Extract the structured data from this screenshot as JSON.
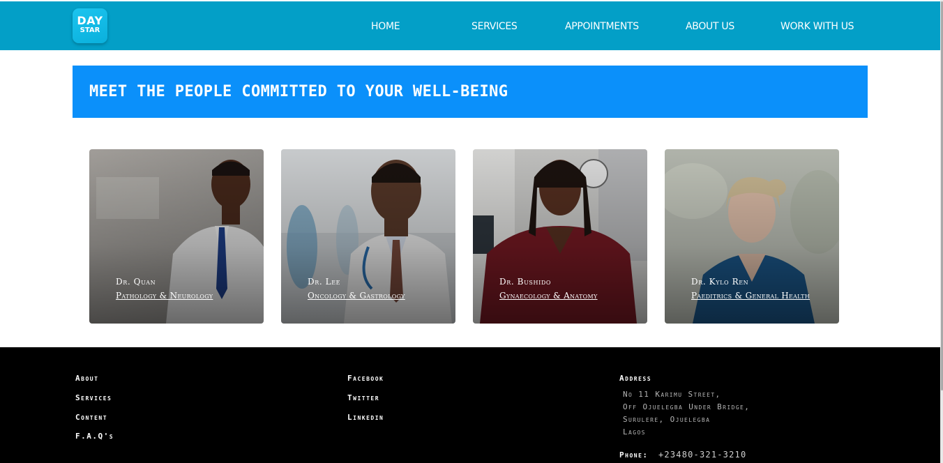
{
  "brand": {
    "logo_line1": "DAY",
    "logo_line2": "STAR",
    "color": "#039fc7"
  },
  "nav": {
    "items": [
      {
        "label": "HOME"
      },
      {
        "label": "SERVICES"
      },
      {
        "label": "APPOINTMENTS"
      },
      {
        "label": "ABOUT US"
      },
      {
        "label": "WORK WITH US"
      }
    ]
  },
  "hero": {
    "title": "MEET THE PEOPLE COMMITTED TO YOUR WELL-BEING",
    "color": "#0b90fa"
  },
  "doctors": [
    {
      "name": "Dr. Quan",
      "specialty": "Pathology & Neurology"
    },
    {
      "name": "Dr. Lee",
      "specialty": "Oncology & Gastrology"
    },
    {
      "name": "Dr. Bushido",
      "specialty": "Gynaecology & Anatomy"
    },
    {
      "name": "Dr. Kylo Ren",
      "specialty": "Paeditrics & General Health"
    }
  ],
  "footer": {
    "col1": [
      {
        "label": "About"
      },
      {
        "label": "Services"
      },
      {
        "label": "Content"
      },
      {
        "label": "F.A.Q's"
      }
    ],
    "col2": [
      {
        "label": "Facebook"
      },
      {
        "label": "Twitter"
      },
      {
        "label": "Linkedin"
      }
    ],
    "address_title": "Address",
    "address_lines": [
      "No 11 Karimu Street,",
      "Off Ojuelegba Under Bridge,",
      "Surulere, Ojuelegba",
      "Lagos"
    ],
    "phone_label": "Phone:",
    "phone_value": "+23480-321-3210"
  }
}
